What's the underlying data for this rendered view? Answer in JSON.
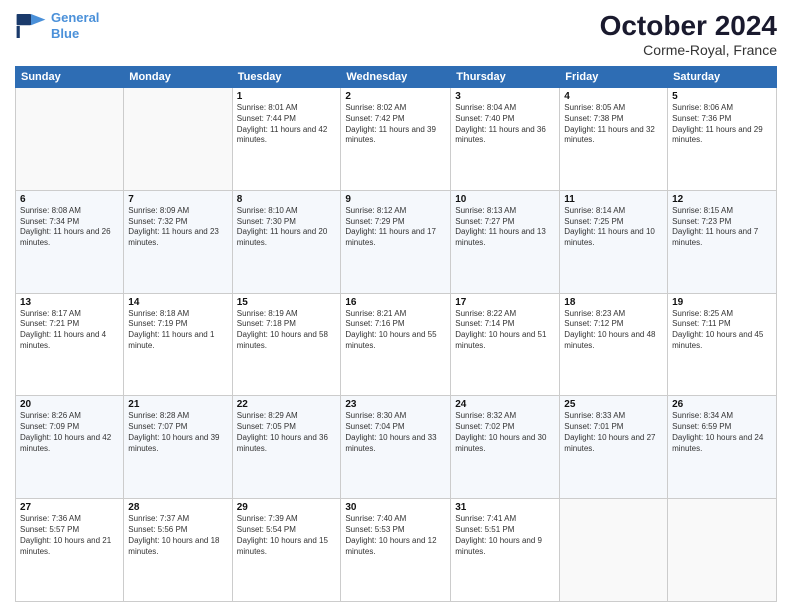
{
  "header": {
    "logo_line1": "General",
    "logo_line2": "Blue",
    "month": "October 2024",
    "location": "Corme-Royal, France"
  },
  "weekdays": [
    "Sunday",
    "Monday",
    "Tuesday",
    "Wednesday",
    "Thursday",
    "Friday",
    "Saturday"
  ],
  "weeks": [
    [
      {
        "day": "",
        "sunrise": "",
        "sunset": "",
        "daylight": ""
      },
      {
        "day": "",
        "sunrise": "",
        "sunset": "",
        "daylight": ""
      },
      {
        "day": "1",
        "sunrise": "Sunrise: 8:01 AM",
        "sunset": "Sunset: 7:44 PM",
        "daylight": "Daylight: 11 hours and 42 minutes."
      },
      {
        "day": "2",
        "sunrise": "Sunrise: 8:02 AM",
        "sunset": "Sunset: 7:42 PM",
        "daylight": "Daylight: 11 hours and 39 minutes."
      },
      {
        "day": "3",
        "sunrise": "Sunrise: 8:04 AM",
        "sunset": "Sunset: 7:40 PM",
        "daylight": "Daylight: 11 hours and 36 minutes."
      },
      {
        "day": "4",
        "sunrise": "Sunrise: 8:05 AM",
        "sunset": "Sunset: 7:38 PM",
        "daylight": "Daylight: 11 hours and 32 minutes."
      },
      {
        "day": "5",
        "sunrise": "Sunrise: 8:06 AM",
        "sunset": "Sunset: 7:36 PM",
        "daylight": "Daylight: 11 hours and 29 minutes."
      }
    ],
    [
      {
        "day": "6",
        "sunrise": "Sunrise: 8:08 AM",
        "sunset": "Sunset: 7:34 PM",
        "daylight": "Daylight: 11 hours and 26 minutes."
      },
      {
        "day": "7",
        "sunrise": "Sunrise: 8:09 AM",
        "sunset": "Sunset: 7:32 PM",
        "daylight": "Daylight: 11 hours and 23 minutes."
      },
      {
        "day": "8",
        "sunrise": "Sunrise: 8:10 AM",
        "sunset": "Sunset: 7:30 PM",
        "daylight": "Daylight: 11 hours and 20 minutes."
      },
      {
        "day": "9",
        "sunrise": "Sunrise: 8:12 AM",
        "sunset": "Sunset: 7:29 PM",
        "daylight": "Daylight: 11 hours and 17 minutes."
      },
      {
        "day": "10",
        "sunrise": "Sunrise: 8:13 AM",
        "sunset": "Sunset: 7:27 PM",
        "daylight": "Daylight: 11 hours and 13 minutes."
      },
      {
        "day": "11",
        "sunrise": "Sunrise: 8:14 AM",
        "sunset": "Sunset: 7:25 PM",
        "daylight": "Daylight: 11 hours and 10 minutes."
      },
      {
        "day": "12",
        "sunrise": "Sunrise: 8:15 AM",
        "sunset": "Sunset: 7:23 PM",
        "daylight": "Daylight: 11 hours and 7 minutes."
      }
    ],
    [
      {
        "day": "13",
        "sunrise": "Sunrise: 8:17 AM",
        "sunset": "Sunset: 7:21 PM",
        "daylight": "Daylight: 11 hours and 4 minutes."
      },
      {
        "day": "14",
        "sunrise": "Sunrise: 8:18 AM",
        "sunset": "Sunset: 7:19 PM",
        "daylight": "Daylight: 11 hours and 1 minute."
      },
      {
        "day": "15",
        "sunrise": "Sunrise: 8:19 AM",
        "sunset": "Sunset: 7:18 PM",
        "daylight": "Daylight: 10 hours and 58 minutes."
      },
      {
        "day": "16",
        "sunrise": "Sunrise: 8:21 AM",
        "sunset": "Sunset: 7:16 PM",
        "daylight": "Daylight: 10 hours and 55 minutes."
      },
      {
        "day": "17",
        "sunrise": "Sunrise: 8:22 AM",
        "sunset": "Sunset: 7:14 PM",
        "daylight": "Daylight: 10 hours and 51 minutes."
      },
      {
        "day": "18",
        "sunrise": "Sunrise: 8:23 AM",
        "sunset": "Sunset: 7:12 PM",
        "daylight": "Daylight: 10 hours and 48 minutes."
      },
      {
        "day": "19",
        "sunrise": "Sunrise: 8:25 AM",
        "sunset": "Sunset: 7:11 PM",
        "daylight": "Daylight: 10 hours and 45 minutes."
      }
    ],
    [
      {
        "day": "20",
        "sunrise": "Sunrise: 8:26 AM",
        "sunset": "Sunset: 7:09 PM",
        "daylight": "Daylight: 10 hours and 42 minutes."
      },
      {
        "day": "21",
        "sunrise": "Sunrise: 8:28 AM",
        "sunset": "Sunset: 7:07 PM",
        "daylight": "Daylight: 10 hours and 39 minutes."
      },
      {
        "day": "22",
        "sunrise": "Sunrise: 8:29 AM",
        "sunset": "Sunset: 7:05 PM",
        "daylight": "Daylight: 10 hours and 36 minutes."
      },
      {
        "day": "23",
        "sunrise": "Sunrise: 8:30 AM",
        "sunset": "Sunset: 7:04 PM",
        "daylight": "Daylight: 10 hours and 33 minutes."
      },
      {
        "day": "24",
        "sunrise": "Sunrise: 8:32 AM",
        "sunset": "Sunset: 7:02 PM",
        "daylight": "Daylight: 10 hours and 30 minutes."
      },
      {
        "day": "25",
        "sunrise": "Sunrise: 8:33 AM",
        "sunset": "Sunset: 7:01 PM",
        "daylight": "Daylight: 10 hours and 27 minutes."
      },
      {
        "day": "26",
        "sunrise": "Sunrise: 8:34 AM",
        "sunset": "Sunset: 6:59 PM",
        "daylight": "Daylight: 10 hours and 24 minutes."
      }
    ],
    [
      {
        "day": "27",
        "sunrise": "Sunrise: 7:36 AM",
        "sunset": "Sunset: 5:57 PM",
        "daylight": "Daylight: 10 hours and 21 minutes."
      },
      {
        "day": "28",
        "sunrise": "Sunrise: 7:37 AM",
        "sunset": "Sunset: 5:56 PM",
        "daylight": "Daylight: 10 hours and 18 minutes."
      },
      {
        "day": "29",
        "sunrise": "Sunrise: 7:39 AM",
        "sunset": "Sunset: 5:54 PM",
        "daylight": "Daylight: 10 hours and 15 minutes."
      },
      {
        "day": "30",
        "sunrise": "Sunrise: 7:40 AM",
        "sunset": "Sunset: 5:53 PM",
        "daylight": "Daylight: 10 hours and 12 minutes."
      },
      {
        "day": "31",
        "sunrise": "Sunrise: 7:41 AM",
        "sunset": "Sunset: 5:51 PM",
        "daylight": "Daylight: 10 hours and 9 minutes."
      },
      {
        "day": "",
        "sunrise": "",
        "sunset": "",
        "daylight": ""
      },
      {
        "day": "",
        "sunrise": "",
        "sunset": "",
        "daylight": ""
      }
    ]
  ]
}
